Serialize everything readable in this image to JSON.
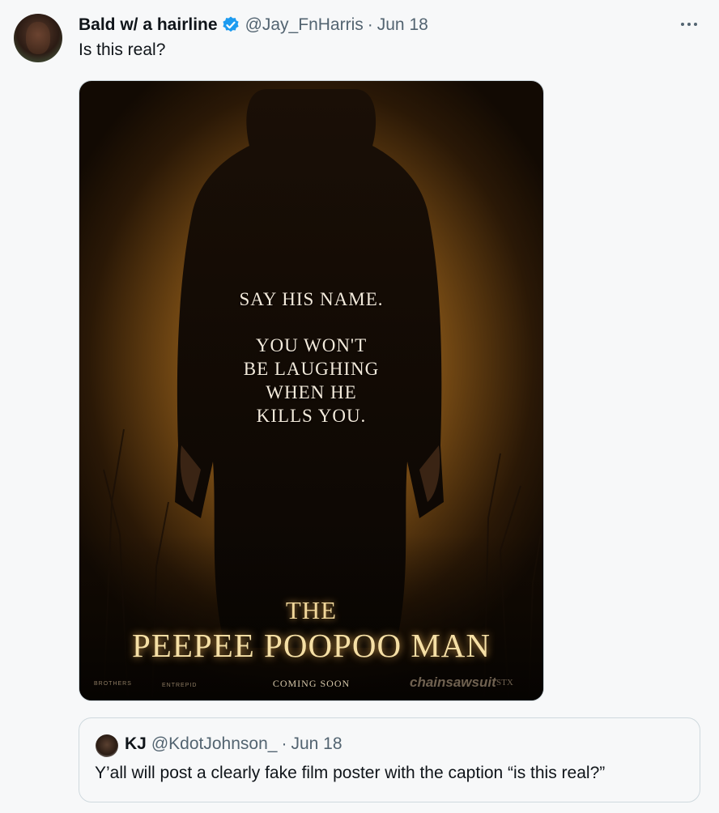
{
  "tweet": {
    "author_name": "Bald w/ a hairline",
    "author_handle": "@Jay_FnHarris",
    "separator": "·",
    "date": "Jun 18",
    "text": "Is this real?",
    "avatar_icon": "user-avatar",
    "verified_icon": "verified-badge-icon",
    "more_icon": "more-options-icon",
    "verified_color": "#1d9bf0"
  },
  "poster": {
    "tagline_line1": "SAY HIS NAME.",
    "tagline_line2": "YOU WON'T",
    "tagline_line3": "BE LAUGHING",
    "tagline_line4": "WHEN HE",
    "tagline_line5": "KILLS YOU.",
    "title_top": "THE",
    "title_main": "PEEPEE POOPOO MAN",
    "coming_soon": "COMING SOON",
    "credit_1": "BROTHERS",
    "credit_2": "ENTREPID",
    "credit_3": "chainsawsuit",
    "credit_4": "STX"
  },
  "quoted_tweet": {
    "author_name": "KJ",
    "author_handle": "@KdotJohnson_",
    "separator": "·",
    "date": "Jun 18",
    "text": "Y’all will post a clearly fake film poster with the caption “is this real?”"
  }
}
